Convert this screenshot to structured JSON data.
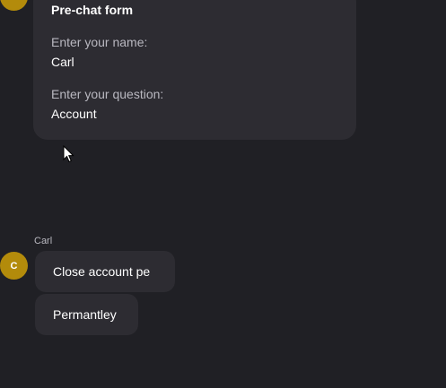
{
  "conversation": {
    "top_avatar_initial": "",
    "form": {
      "title": "Pre-chat form",
      "name_label": "Enter your name:",
      "name_value": "Carl",
      "question_label": "Enter your question:",
      "question_value": "Account"
    },
    "user_message_group": {
      "sender": "Carl",
      "avatar_initial": "C",
      "messages": [
        "Close account pe",
        "Permantley"
      ]
    }
  },
  "colors": {
    "background": "#202025",
    "bubble": "#2d2c32",
    "avatar": "#b38b0b",
    "muted_text": "#b9b8c0"
  },
  "icons": {
    "cursor": "mouse-pointer-icon"
  }
}
